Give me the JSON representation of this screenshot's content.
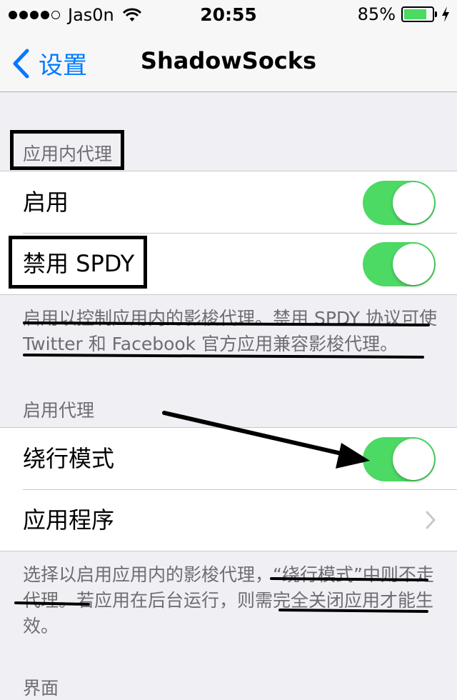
{
  "status_bar": {
    "carrier": "Jas0n",
    "time": "20:55",
    "battery_percent": "85%",
    "battery_level": 0.85,
    "signal_bars_filled": 4,
    "signal_bars_total": 5
  },
  "nav": {
    "back_label": "设置",
    "title": "ShadowSocks"
  },
  "in_app_proxy": {
    "header": "应用内代理",
    "items": [
      {
        "label": "启用",
        "toggle": true
      },
      {
        "label": "禁用 SPDY",
        "toggle": true
      }
    ],
    "footer": "启用以控制应用内的影梭代理。禁用 SPDY 协议可使 Twitter 和 Facebook 官方应用兼容影梭代理。"
  },
  "enable_proxy": {
    "header": "启用代理",
    "items": [
      {
        "label": "绕行模式",
        "toggle": true
      },
      {
        "label": "应用程序",
        "disclosure": true
      }
    ],
    "footer": "选择以启用应用内的影梭代理，“绕行模式”中则不走代理。若应用在后台运行，则需完全关闭应用才能生效。"
  },
  "next_section": {
    "header": "界面"
  },
  "colors": {
    "accent": "#007aff",
    "toggle_on": "#4cd964",
    "background": "#efeff4",
    "separator": "#c8c7cc",
    "footer_text": "#6d6d72"
  }
}
